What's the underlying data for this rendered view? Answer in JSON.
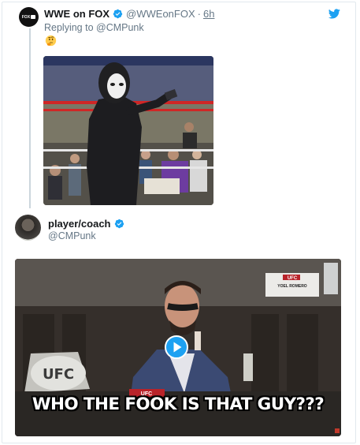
{
  "reply_tweet": {
    "display_name": "WWE on FOX",
    "handle": "@WWEonFOX",
    "separator": "·",
    "time": "6h",
    "replying_to": "Replying to @CMPunk",
    "emoji": "thinking-face",
    "avatar_text": "FOX"
  },
  "quoted_tweet": {
    "display_name": "player/coach",
    "handle": "@CMPunk",
    "media_caption": "WHO THE FOOK IS THAT GUY???",
    "podium_sign": "UFC",
    "name_card": "YOEL ROMERO",
    "belt_text": "UFC"
  },
  "colors": {
    "verified": "#1da1f2",
    "twitter_blue": "#1da1f2",
    "secondary_text": "#657786",
    "thread_line": "#ccd6dd"
  }
}
